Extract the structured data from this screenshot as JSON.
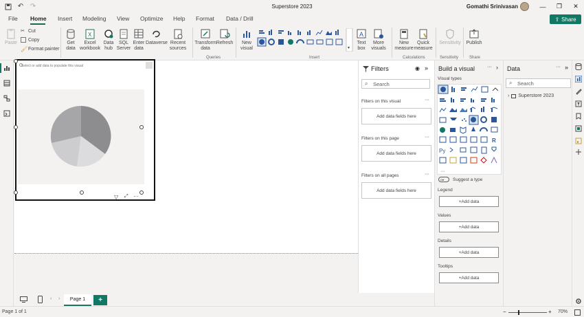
{
  "window": {
    "title": "Superstore 2023",
    "user": "Gomathi Srinivasan",
    "minimize": "—",
    "maximize": "❐",
    "close": "✕"
  },
  "menu": {
    "file": "File",
    "home": "Home",
    "insert": "Insert",
    "modeling": "Modeling",
    "view": "View",
    "optimize": "Optimize",
    "help": "Help",
    "format": "Format",
    "data_drill": "Data / Drill",
    "share": "Share"
  },
  "ribbon": {
    "paste": "Paste",
    "cut": "Cut",
    "copy": "Copy",
    "format_painter": "Format painter",
    "get_data": "Get data",
    "excel_workbook": "Excel workbook",
    "data_hub": "Data hub",
    "sql_server": "SQL Server",
    "enter_data": "Enter data",
    "dataverse": "Dataverse",
    "recent_sources": "Recent sources",
    "transform_data": "Transform data",
    "refresh": "Refresh",
    "new_visual": "New visual",
    "text_box": "Text box",
    "more_visuals": "More visuals",
    "new_measure": "New measure",
    "quick_measure": "Quick measure",
    "sensitivity": "Sensitivity",
    "publish": "Publish",
    "groups": {
      "queries": "Queries",
      "insert": "Insert",
      "calculations": "Calculations",
      "sensitivity": "Sensitivity",
      "share": "Share"
    }
  },
  "canvas": {
    "visual_hint": "Select or add data to populate this visual"
  },
  "filters": {
    "title": "Filters",
    "search_placeholder": "Search",
    "on_visual": "Filters on this visual",
    "on_page": "Filters on this page",
    "on_all_pages": "Filters on all pages",
    "add_fields": "Add data fields here"
  },
  "build": {
    "title": "Build a visual",
    "visual_types": "Visual types",
    "suggest": "Suggest a type",
    "toggle": "Off",
    "legend": "Legend",
    "values": "Values",
    "details": "Details",
    "tooltips": "Tooltips",
    "add_data": "+Add data"
  },
  "data": {
    "title": "Data",
    "search_placeholder": "Search",
    "table": "Superstore 2023"
  },
  "pages": {
    "page1": "Page 1",
    "add": "+"
  },
  "status": {
    "page_info": "Page 1 of 1",
    "zoom": "70%"
  },
  "colors": {
    "accent": "#117865",
    "pie_dark": "#8d8d90",
    "pie_mid": "#a6a6a8",
    "pie_light": "#cdcdcf",
    "pie_lighter": "#dcdcde"
  }
}
